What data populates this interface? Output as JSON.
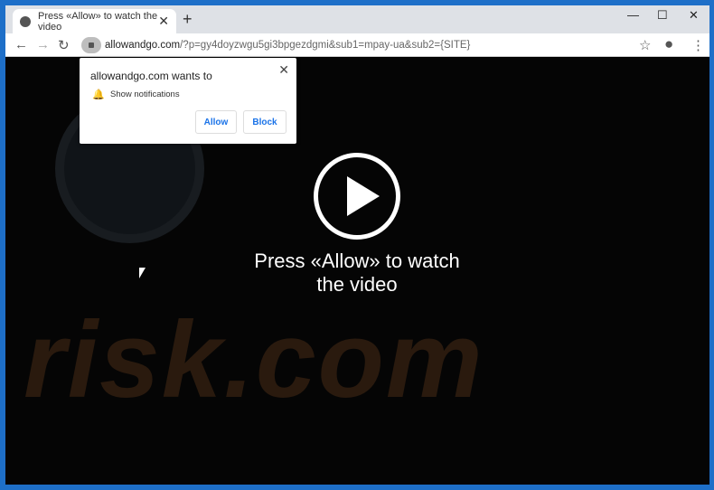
{
  "tab": {
    "title": "Press «Allow» to watch the video",
    "close": "✕",
    "new_tab": "+",
    "icon": "globe-icon"
  },
  "window_controls": {
    "minimize": "—",
    "maximize": "☐",
    "close": "✕"
  },
  "toolbar": {
    "back": "←",
    "forward": "→",
    "reload": "↻",
    "star": "☆",
    "account": "●",
    "menu": "⋮"
  },
  "address": {
    "domain": "allowandgo.com",
    "path": "/?p=gy4doyzwgu5gi3bpgezdgmi&sub1=mpay-ua&sub2={SITE}"
  },
  "popup": {
    "title": "allowandgo.com wants to",
    "permission": "Show notifications",
    "allow": "Allow",
    "block": "Block",
    "close": "✕"
  },
  "page": {
    "line1": "Press «Allow» to watch",
    "line2": "the video",
    "watermark": "risk.com"
  },
  "colors": {
    "frame": "#1e6fc8",
    "button_text": "#1a73e8"
  }
}
